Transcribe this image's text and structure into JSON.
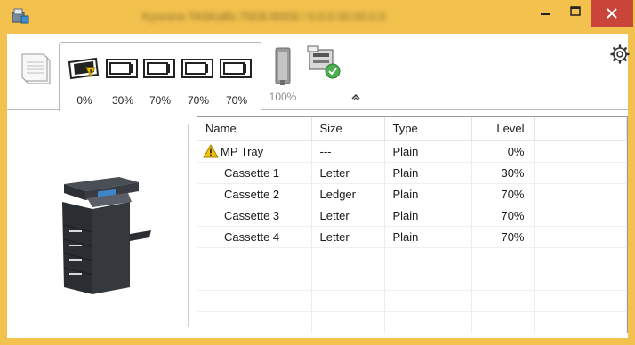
{
  "window": {
    "title": "Kyocera TASKalfa 7003i 8003i / 0.0.0 00.00.0.0"
  },
  "toolbar": {
    "trays": [
      {
        "name": "MP Tray",
        "percent": "0%",
        "warning": true
      },
      {
        "name": "Cassette 1",
        "percent": "30%",
        "warning": false
      },
      {
        "name": "Cassette 2",
        "percent": "70%",
        "warning": false
      },
      {
        "name": "Cassette 3",
        "percent": "70%",
        "warning": false
      },
      {
        "name": "Cassette 4",
        "percent": "70%",
        "warning": false
      }
    ],
    "toner_percent": "100%"
  },
  "table": {
    "headers": {
      "name": "Name",
      "size": "Size",
      "type": "Type",
      "level": "Level"
    },
    "rows": [
      {
        "name": "MP Tray",
        "size": "---",
        "type": "Plain",
        "level": "0%",
        "warning": true
      },
      {
        "name": "Cassette 1",
        "size": "Letter",
        "type": "Plain",
        "level": "30%"
      },
      {
        "name": "Cassette 2",
        "size": "Ledger",
        "type": "Plain",
        "level": "70%"
      },
      {
        "name": "Cassette 3",
        "size": "Letter",
        "type": "Plain",
        "level": "70%"
      },
      {
        "name": "Cassette 4",
        "size": "Letter",
        "type": "Plain",
        "level": "70%"
      }
    ]
  },
  "colors": {
    "titlebar": "#f2c14e",
    "close_button": "#c9453a",
    "warning": "#f5c400",
    "ok_badge": "#4caf50"
  },
  "icons": {
    "app": "printer-status-icon",
    "paper": "paper-stack-icon",
    "tray": "paper-tray-icon",
    "toner": "toner-icon",
    "finisher": "finisher-ok-icon",
    "settings": "gear-icon",
    "collapse": "chevron-up-icon",
    "warning": "warning-icon"
  }
}
